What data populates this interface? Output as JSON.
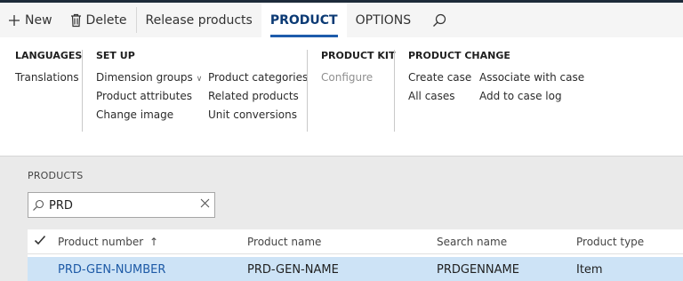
{
  "action_bar": {
    "new_label": "New",
    "delete_label": "Delete",
    "release_label": "Release products",
    "tabs": [
      {
        "label": "PRODUCT",
        "active": true
      },
      {
        "label": "OPTIONS",
        "active": false
      }
    ]
  },
  "ribbon": {
    "languages": {
      "title": "LANGUAGES",
      "items": [
        "Translations"
      ]
    },
    "setup": {
      "title": "SET UP",
      "col1": [
        "Dimension groups",
        "Product attributes",
        "Change image"
      ],
      "col2": [
        "Product categories",
        "Related products",
        "Unit conversions"
      ]
    },
    "product_kit": {
      "title": "PRODUCT KIT",
      "items": [
        "Configure"
      ]
    },
    "product_change": {
      "title": "PRODUCT CHANGE",
      "col1": [
        "Create case",
        "All cases"
      ],
      "col2": [
        "Associate with case",
        "Add to case log"
      ]
    }
  },
  "products": {
    "section_label": "PRODUCTS",
    "search": {
      "value": "PRD"
    },
    "columns": [
      "Product number",
      "Product name",
      "Search name",
      "Product type"
    ],
    "sort_indicator": "↑",
    "rows": [
      {
        "number": "PRD-GEN-NUMBER",
        "name": "PRD-GEN-NAME",
        "search_name": "PRDGENNAME",
        "type": "Item"
      }
    ]
  },
  "colors": {
    "accent": "#1e5cab",
    "selected_row": "#cde3f6",
    "link": "#1d5aa6"
  },
  "icons": [
    "plus-icon",
    "trash-icon",
    "search-icon",
    "close-icon",
    "chevron-down-icon",
    "checkmark-icon",
    "sort-up-icon"
  ]
}
